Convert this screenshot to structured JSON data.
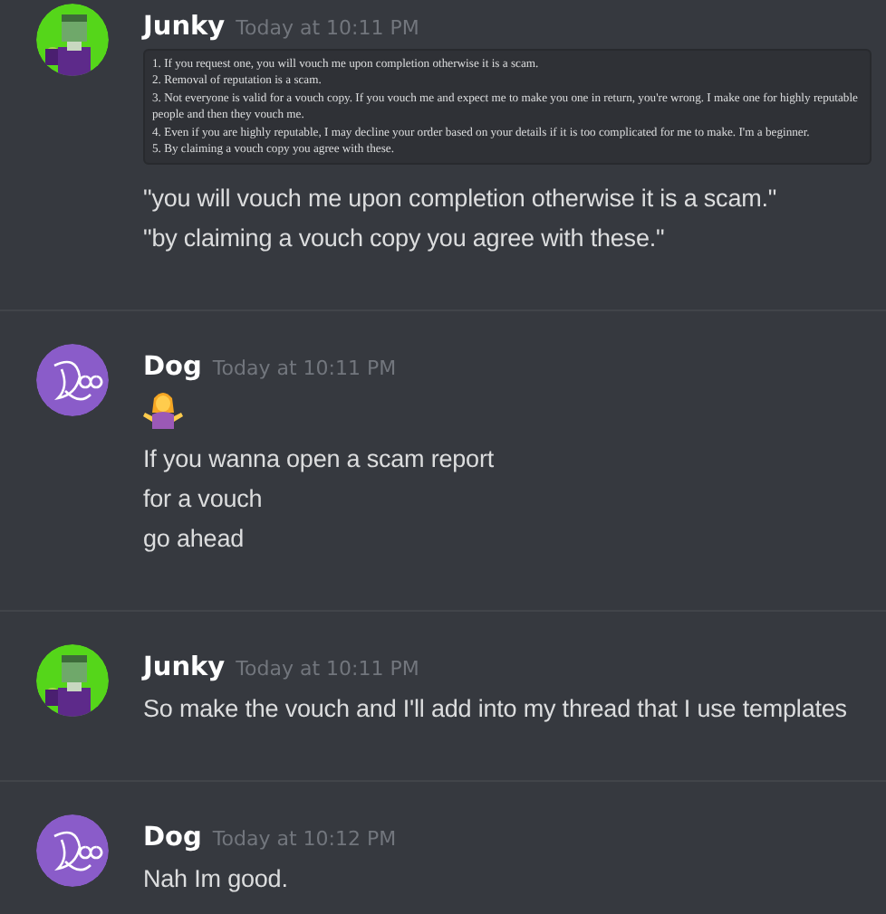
{
  "messages": [
    {
      "author": "Junky",
      "timestamp": "Today at 10:11 PM",
      "avatar": {
        "kind": "pixel"
      },
      "blocks": [
        {
          "kind": "code",
          "lines": [
            "1. If you request one, you will vouch me upon completion otherwise it is a scam.",
            "2. Removal of reputation is a scam.",
            "3. Not everyone is valid for a vouch copy. If you vouch me and expect me to make you one in return, you're wrong. I make one for highly reputable people and then they vouch me.",
            "4. Even if you are highly reputable, I may decline your order based on your details if it is too complicated for me to make. I'm a beginner.",
            "5. By claiming a vouch copy you agree with these."
          ]
        },
        {
          "kind": "text",
          "text": "\"you will vouch me upon completion otherwise it is a scam.\""
        },
        {
          "kind": "text",
          "text": "\"by claiming a vouch copy you agree with these.\""
        }
      ]
    },
    {
      "author": "Dog",
      "timestamp": "Today at 10:11 PM",
      "avatar": {
        "kind": "scribble"
      },
      "blocks": [
        {
          "kind": "emoji"
        },
        {
          "kind": "text",
          "text": "If you wanna open a scam report"
        },
        {
          "kind": "text",
          "text": "for a vouch"
        },
        {
          "kind": "text",
          "text": "go ahead"
        }
      ]
    },
    {
      "author": "Junky",
      "timestamp": "Today at 10:11 PM",
      "avatar": {
        "kind": "pixel"
      },
      "blocks": [
        {
          "kind": "text",
          "text": "So make the vouch and I'll add into my thread that I use templates"
        }
      ]
    },
    {
      "author": "Dog",
      "timestamp": "Today at 10:12 PM",
      "avatar": {
        "kind": "scribble"
      },
      "blocks": [
        {
          "kind": "text",
          "text": "Nah Im good."
        }
      ]
    }
  ]
}
